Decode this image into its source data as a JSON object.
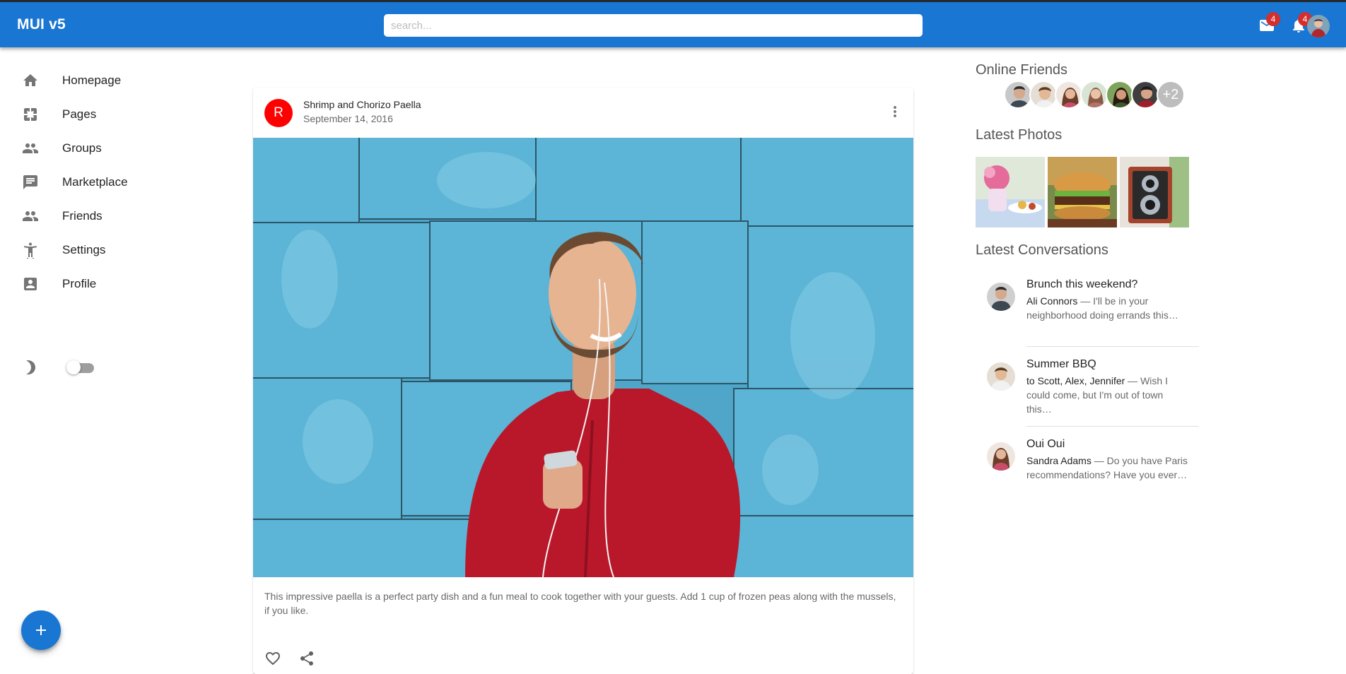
{
  "appbar": {
    "brand": "MUI v5",
    "search_placeholder": "search...",
    "mail_badge": "4",
    "notifications_badge": "4",
    "icons": [
      "mail-icon",
      "notifications-icon"
    ]
  },
  "sidebar": {
    "items": [
      {
        "label": "Homepage",
        "icon": "home-icon"
      },
      {
        "label": "Pages",
        "icon": "pages-icon"
      },
      {
        "label": "Groups",
        "icon": "groups-icon"
      },
      {
        "label": "Marketplace",
        "icon": "marketplace-icon"
      },
      {
        "label": "Friends",
        "icon": "friends-icon"
      },
      {
        "label": "Settings",
        "icon": "settings-icon"
      },
      {
        "label": "Profile",
        "icon": "profile-icon"
      }
    ],
    "mode_icon": "dark-mode-icon",
    "fab_icon": "add-icon"
  },
  "post": {
    "avatar_letter": "R",
    "title": "Shrimp and Chorizo Paella",
    "date": "September 14, 2016",
    "text": "This impressive paella is a perfect party dish and a fun meal to cook together with your guests. Add 1 cup of frozen peas along with the mussels, if you like."
  },
  "rightbar": {
    "online_friends_title": "Online Friends",
    "online_more": "+2",
    "latest_photos_title": "Latest Photos",
    "latest_conversations_title": "Latest Conversations",
    "conversations": [
      {
        "title": "Brunch this weekend?",
        "who": "Ali Connors",
        "text": " — I'll be in your neighborhood doing errands this…"
      },
      {
        "title": "Summer BBQ",
        "who": "to Scott, Alex, Jennifer",
        "text": " — Wish I could come, but I'm out of town this…"
      },
      {
        "title": "Oui Oui",
        "who": "Sandra Adams",
        "text": " — Do you have Paris recommendations? Have you ever…"
      }
    ]
  },
  "colors": {
    "primary": "#1976d2",
    "badge": "#d32f2f",
    "post_avatar": "#ff0000"
  }
}
